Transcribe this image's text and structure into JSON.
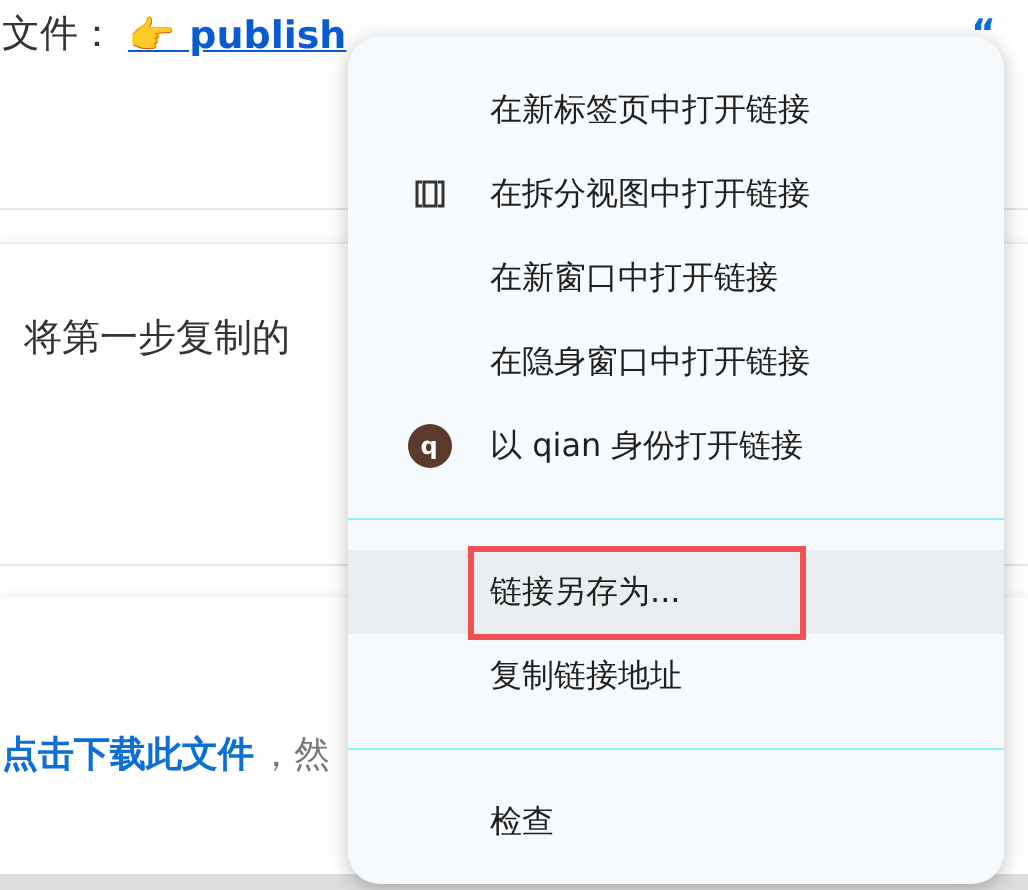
{
  "page": {
    "line_1": {
      "prefix": "文件：",
      "link": "👉 publish",
      "quote": "“"
    },
    "line_2": {
      "text": "将第一步复制的"
    },
    "line_3": {
      "link": "点击下载此文件",
      "text": "，然"
    }
  },
  "context_menu": {
    "items": [
      {
        "kind": "item",
        "label": "在新标签页中打开链接",
        "selected": false,
        "outlined": false
      },
      {
        "kind": "split_item",
        "label": "在拆分视图中打开链接",
        "selected": false,
        "outlined": false
      },
      {
        "kind": "item",
        "label": "在新窗口中打开链接",
        "selected": false,
        "outlined": false
      },
      {
        "kind": "item",
        "label": "在隐身窗口中打开链接",
        "selected": false,
        "outlined": false
      },
      {
        "kind": "profile_item",
        "label": "以 qian 身份打开链接",
        "avatar_letter": "q",
        "selected": false,
        "outlined": false
      },
      {
        "kind": "separator"
      },
      {
        "kind": "item",
        "label": "链接另存为...",
        "selected": true,
        "outlined": true
      },
      {
        "kind": "item",
        "label": "复制链接地址",
        "selected": false,
        "outlined": false
      },
      {
        "kind": "separator"
      },
      {
        "kind": "item",
        "label": "检查",
        "selected": false,
        "outlined": false
      }
    ]
  }
}
